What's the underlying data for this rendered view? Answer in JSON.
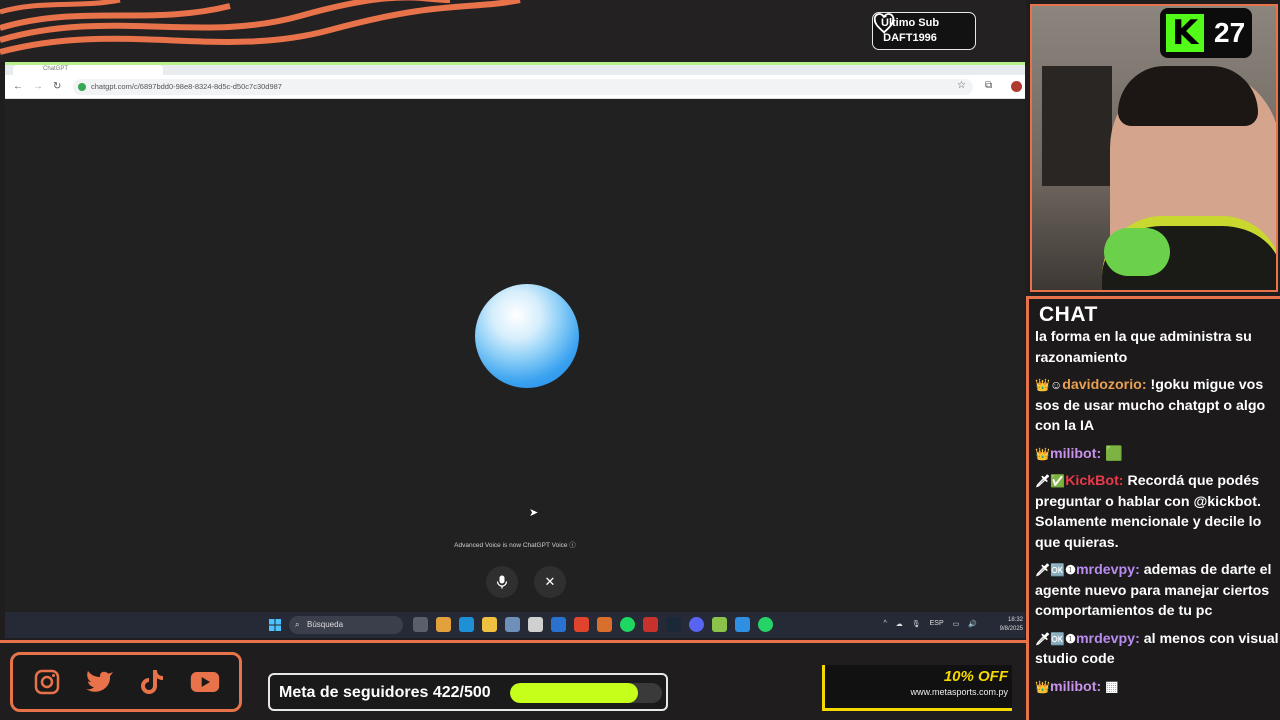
{
  "overlay": {
    "last_sub_label": "Último Sub",
    "last_sub_user": "DAFT1996",
    "kick_viewers": "27",
    "kick_logo": "K",
    "chat_title": "CHAT",
    "follower_goal": "Meta de seguidores 422/500",
    "follower_progress": 0.844,
    "ad_offer": "10% OFF",
    "ad_site": "www.metasports.com.py",
    "accent_color": "#e8734a",
    "kick_green": "#53fc18"
  },
  "browser": {
    "tab_title": "ChatGPT",
    "url": "chatgpt.com/c/6897bdd0-98e8-8324-8d5c-d50c7c30d987"
  },
  "voice": {
    "note": "Advanced Voice is now ChatGPT Voice ⓘ",
    "mic_icon": "microphone-icon",
    "close_icon": "close-icon"
  },
  "taskbar": {
    "search_placeholder": "Búsqueda",
    "lang": "ESP",
    "time": "18:32",
    "date": "9/8/2025"
  },
  "chat": {
    "messages": [
      {
        "badges": "👑☺",
        "user": "davidozorio",
        "color": "#e8a050",
        "text": "!goku migue vos sos de usar mucho chatgpt o algo con la IA"
      },
      {
        "badges": "👑",
        "user": "milibot",
        "color": "#c792ea",
        "text": "🟩"
      },
      {
        "badges": "🗡✅",
        "user": "KickBot",
        "color": "#e83a4a",
        "text": "Recordá que podés preguntar o hablar con @kickbot. Solamente mencionale y decile lo que quieras."
      },
      {
        "badges": "🗡🆗❶",
        "user": "mrdevpy",
        "color": "#b98cf0",
        "text": "ademas de darte el agente nuevo para manejar ciertos comportamientos de tu pc"
      },
      {
        "badges": "🗡🆗❶",
        "user": "mrdevpy",
        "color": "#b98cf0",
        "text": "al menos con visual studio code"
      },
      {
        "badges": "👑",
        "user": "milibot",
        "color": "#c792ea",
        "text": "▦"
      }
    ],
    "partial_top": "la forma en la que administra su razonamiento"
  }
}
